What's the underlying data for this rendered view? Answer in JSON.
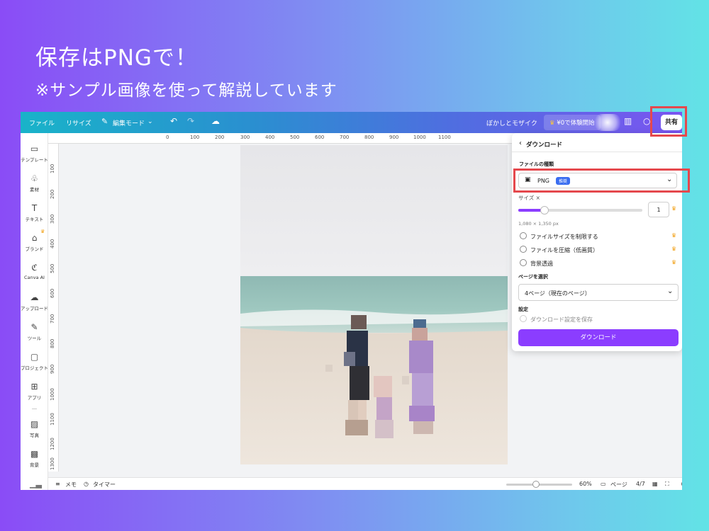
{
  "slide": {
    "title": "保存はPNGで！",
    "subtitle": "※サンプル画像を使って解説しています"
  },
  "topbar": {
    "file": "ファイル",
    "resize": "リサイズ",
    "edit_mode": "編集モード",
    "project_name": "ぼかしとモザイク",
    "trial": "¥0で体験開始",
    "share": "共有"
  },
  "sidebar": {
    "items": [
      {
        "label": "テンプレート",
        "icon": "▭"
      },
      {
        "label": "素材",
        "icon": "♧"
      },
      {
        "label": "テキスト",
        "icon": "T"
      },
      {
        "label": "ブランド",
        "icon": "⌂"
      },
      {
        "label": "Canva AI",
        "icon": "ℭ"
      },
      {
        "label": "アップロード",
        "icon": "☁"
      },
      {
        "label": "ツール",
        "icon": "✎"
      },
      {
        "label": "プロジェクト",
        "icon": "▢"
      },
      {
        "label": "アプリ",
        "icon": "⊞"
      },
      {
        "label": "写真",
        "icon": "▨"
      },
      {
        "label": "背景",
        "icon": "▩"
      }
    ]
  },
  "rulers": {
    "top": [
      "0",
      "100",
      "200",
      "300",
      "400",
      "500",
      "600",
      "700",
      "800",
      "900",
      "1000",
      "1100"
    ],
    "left": [
      "100",
      "200",
      "300",
      "400",
      "500",
      "600",
      "700",
      "800",
      "900",
      "1000",
      "1100",
      "1200",
      "1300"
    ]
  },
  "download_panel": {
    "title": "ダウンロード",
    "file_type_label": "ファイルの種類",
    "file_type_value": "PNG",
    "recommended_badge": "推奨",
    "size_label": "サイズ ×",
    "size_value": "1",
    "size_fraction": 0.21,
    "dimensions": "1,080 × 1,350 px",
    "options": [
      {
        "label": "ファイルサイズを制限する",
        "checked": false
      },
      {
        "label": "ファイルを圧縮（低画質）",
        "checked": false
      },
      {
        "label": "背景透過",
        "checked": false
      }
    ],
    "page_select_label": "ページを選択",
    "page_select_value": "4ページ（現在のページ）",
    "settings_label": "設定",
    "save_settings": "ダウンロード設定を保存",
    "download_button": "ダウンロード"
  },
  "bottombar": {
    "notes": "メモ",
    "timer": "タイマー",
    "zoom": "60%",
    "zoom_fraction": 0.45,
    "pages": "ページ",
    "page_count": "4/7"
  },
  "colors": {
    "accent": "#8b3dff",
    "highlight": "#e5484d",
    "badge": "#3a6df0"
  }
}
